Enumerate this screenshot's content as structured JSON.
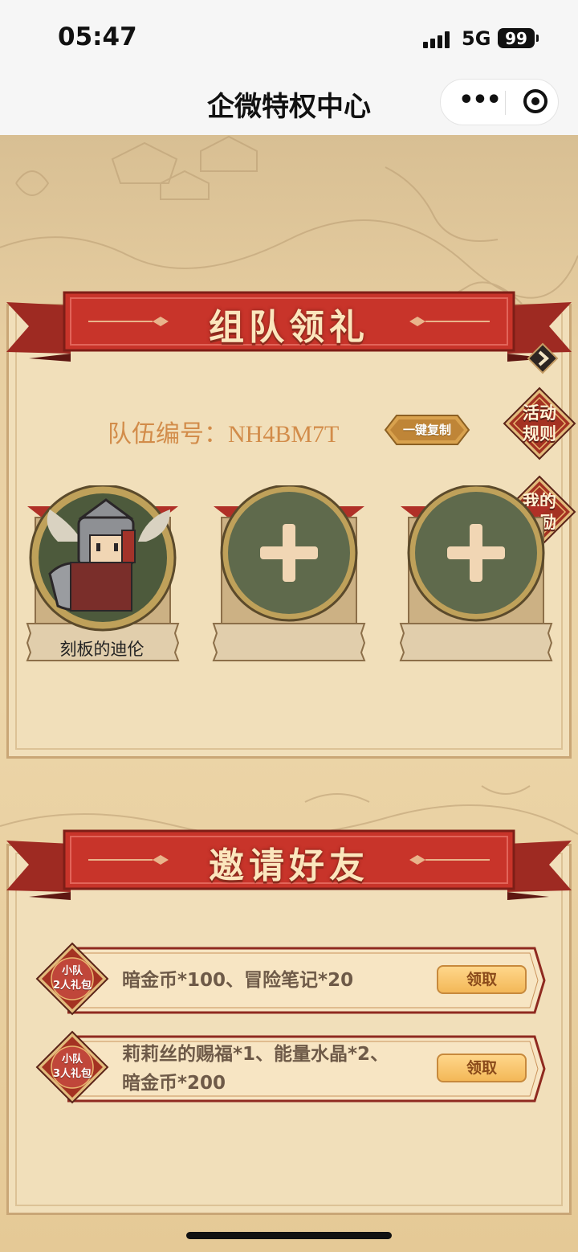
{
  "status_bar": {
    "time": "05:47",
    "network": "5G",
    "battery": "99"
  },
  "nav": {
    "title": "企微特权中心"
  },
  "team_section": {
    "title": "组队领礼",
    "team_code": "队伍编号：NH4BM7T",
    "copy_button": "一键复制",
    "rules_button": "活动\n规则",
    "rewards_button": "我的\n奖励",
    "members": [
      {
        "name": "刻板的迪伦",
        "filled": true
      },
      {
        "name": "",
        "filled": false
      },
      {
        "name": "",
        "filled": false
      }
    ]
  },
  "invite_section": {
    "title": "邀请好友",
    "rewards": [
      {
        "badge": "小队\n2人礼包",
        "desc": "暗金币*100、冒险笔记*20",
        "button": "领取"
      },
      {
        "badge": "小队\n3人礼包",
        "desc": "莉莉丝的赐福*1、能量水晶*2、\n暗金币*200",
        "button": "领取"
      }
    ]
  },
  "colors": {
    "ribbon": "#c8342a",
    "panel": "#f1dfba",
    "accent_text": "#d28c4a",
    "slot_green": "#5f6a4c"
  }
}
